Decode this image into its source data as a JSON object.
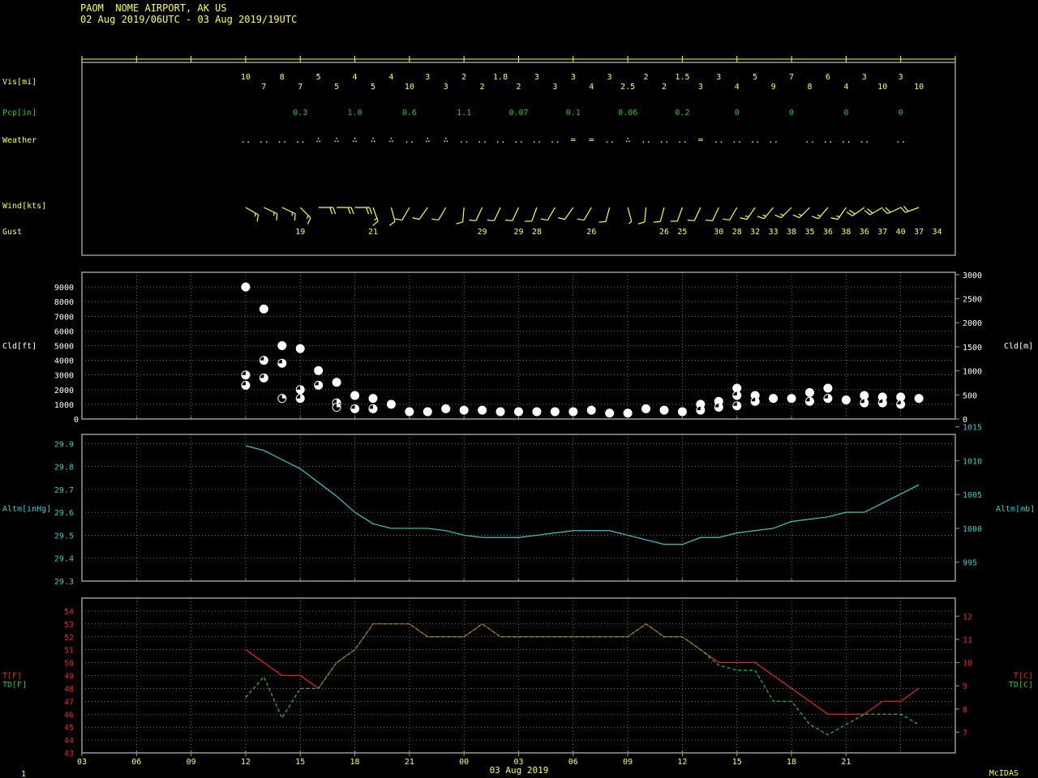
{
  "header": {
    "title": "PAOM  NOME AIRPORT, AK US",
    "subtitle": "02 Aug 2019/06UTC - 03 Aug 2019/19UTC"
  },
  "footer": {
    "left_label": "1",
    "date_label": "03 Aug 2019",
    "brand": "McIDAS"
  },
  "colors": {
    "yellow": "#ffff44",
    "green": "#22cc22",
    "cyan": "#33cccc",
    "red": "#ee2222",
    "white": "#ffffff",
    "frame": "#999999",
    "grid": "#aaaaaa"
  },
  "chart_data": [
    {
      "type": "table",
      "title": "Surface observations",
      "x_range": [
        -3,
        45
      ],
      "x_tick_labels": [
        "03",
        "06",
        "09",
        "12",
        "15",
        "18",
        "21",
        "00",
        "03",
        "06",
        "09",
        "12",
        "15",
        "18",
        "21"
      ],
      "hours": [
        6,
        7,
        8,
        9,
        10,
        11,
        12,
        13,
        14,
        15,
        16,
        17,
        18,
        19,
        20,
        21,
        22,
        23,
        24,
        25,
        26,
        27,
        28,
        29,
        30,
        31,
        32,
        33,
        34,
        35,
        36,
        37,
        38,
        39,
        40,
        41,
        42,
        43
      ],
      "rows": {
        "vis_label": "Vis[mi]",
        "vis": [
          "10",
          "7",
          "8",
          "7",
          "5",
          "5",
          "4",
          "5",
          "4",
          "10",
          "3",
          "3",
          "2",
          "2",
          "1.8",
          "2",
          "3",
          "3",
          "3",
          "4",
          "3",
          "2.5",
          "2",
          "2",
          "1.5",
          "3",
          "3",
          "4",
          "5",
          "9",
          "7",
          "8",
          "6",
          "4",
          "3",
          "10",
          "3",
          "10"
        ],
        "pcp_label": "Pcp[in]",
        "pcp": [
          {
            "hour": 9,
            "value": "0.3"
          },
          {
            "hour": 12,
            "value": "1.0"
          },
          {
            "hour": 15,
            "value": "0.6"
          },
          {
            "hour": 18,
            "value": "1.1"
          },
          {
            "hour": 21,
            "value": "0.07"
          },
          {
            "hour": 24,
            "value": "0.1"
          },
          {
            "hour": 27,
            "value": "0.06"
          },
          {
            "hour": 30,
            "value": "0.2"
          },
          {
            "hour": 33,
            "value": "0"
          },
          {
            "hour": 36,
            "value": "0"
          },
          {
            "hour": 39,
            "value": "0"
          },
          {
            "hour": 42,
            "value": "0"
          }
        ],
        "weather_label": "Weather",
        "weather": [
          "..",
          "..",
          "..",
          "..",
          "∴",
          "∴",
          "∴",
          "∴",
          "∴",
          "..",
          "∴",
          "∴",
          "..",
          "..",
          "..",
          "..",
          "..",
          "..",
          "=",
          "=",
          "..",
          "∴",
          "..",
          "..",
          "..",
          "=",
          "..",
          "..",
          "..",
          "..",
          "",
          "..",
          "..",
          "..",
          "..",
          "",
          ".."
        ],
        "wind_label": "Wind[kts]",
        "wind": [
          {
            "dir": 120,
            "spd": 15
          },
          {
            "dir": 115,
            "spd": 15
          },
          {
            "dir": 115,
            "spd": 15
          },
          {
            "dir": 135,
            "spd": 15
          },
          {
            "dir": 90,
            "spd": 20
          },
          {
            "dir": 90,
            "spd": 20
          },
          {
            "dir": 90,
            "spd": 20
          },
          {
            "dir": 160,
            "spd": 15
          },
          {
            "dir": 165,
            "spd": 10
          },
          {
            "dir": 210,
            "spd": 10
          },
          {
            "dir": 215,
            "spd": 10
          },
          {
            "dir": 210,
            "spd": 10
          },
          {
            "dir": 185,
            "spd": 10
          },
          {
            "dir": 205,
            "spd": 10
          },
          {
            "dir": 205,
            "spd": 10
          },
          {
            "dir": 205,
            "spd": 10
          },
          {
            "dir": 200,
            "spd": 10
          },
          {
            "dir": 210,
            "spd": 10
          },
          {
            "dir": 215,
            "spd": 10
          },
          {
            "dir": 210,
            "spd": 10
          },
          {
            "dir": 195,
            "spd": 10
          },
          {
            "dir": 165,
            "spd": 5
          },
          {
            "dir": 185,
            "spd": 10
          },
          {
            "dir": 195,
            "spd": 10
          },
          {
            "dir": 200,
            "spd": 10
          },
          {
            "dir": 205,
            "spd": 10
          },
          {
            "dir": 205,
            "spd": 10
          },
          {
            "dir": 210,
            "spd": 10
          },
          {
            "dir": 215,
            "spd": 15
          },
          {
            "dir": 220,
            "spd": 15
          },
          {
            "dir": 225,
            "spd": 15
          },
          {
            "dir": 225,
            "spd": 15
          },
          {
            "dir": 220,
            "spd": 15
          },
          {
            "dir": 215,
            "spd": 15
          },
          {
            "dir": 235,
            "spd": 20
          },
          {
            "dir": 240,
            "spd": 20
          },
          {
            "dir": 245,
            "spd": 20
          },
          {
            "dir": 250,
            "spd": 20
          }
        ],
        "gust_label": "Gust",
        "gust": [
          {
            "hour": 9,
            "value": "19"
          },
          {
            "hour": 13,
            "value": "21"
          },
          {
            "hour": 19,
            "value": "29"
          },
          {
            "hour": 21,
            "value": "29"
          },
          {
            "hour": 22,
            "value": "28"
          },
          {
            "hour": 25,
            "value": "26"
          },
          {
            "hour": 29,
            "value": "26"
          },
          {
            "hour": 30,
            "value": "25"
          },
          {
            "hour": 32,
            "value": "30"
          },
          {
            "hour": 33,
            "value": "28"
          },
          {
            "hour": 34,
            "value": "32"
          },
          {
            "hour": 35,
            "value": "33"
          },
          {
            "hour": 36,
            "value": "38"
          },
          {
            "hour": 37,
            "value": "35"
          },
          {
            "hour": 38,
            "value": "36"
          },
          {
            "hour": 39,
            "value": "38"
          },
          {
            "hour": 40,
            "value": "36"
          },
          {
            "hour": 41,
            "value": "37"
          },
          {
            "hour": 42,
            "value": "40"
          },
          {
            "hour": 43,
            "value": "37"
          },
          {
            "hour": 44,
            "value": "34"
          }
        ]
      }
    },
    {
      "type": "scatter",
      "ylabel": "Cld[ft]",
      "ylabel_right": "Cld[m]",
      "ylim": [
        0,
        10000
      ],
      "yticks": [
        1000,
        2000,
        3000,
        4000,
        5000,
        6000,
        7000,
        8000,
        9000
      ],
      "yticks_right_m": [
        0,
        500,
        1000,
        1500,
        2000,
        2500,
        3000
      ],
      "points": [
        {
          "hour": 6,
          "ft": 9000,
          "cover": "ovc"
        },
        {
          "hour": 6,
          "ft": 3000,
          "cover": "bkn"
        },
        {
          "hour": 6,
          "ft": 2300,
          "cover": "bkn"
        },
        {
          "hour": 7,
          "ft": 7500,
          "cover": "ovc"
        },
        {
          "hour": 7,
          "ft": 4000,
          "cover": "bkn"
        },
        {
          "hour": 7,
          "ft": 2800,
          "cover": "bkn"
        },
        {
          "hour": 8,
          "ft": 5000,
          "cover": "ovc"
        },
        {
          "hour": 8,
          "ft": 3800,
          "cover": "bkn"
        },
        {
          "hour": 8,
          "ft": 1400,
          "cover": "sct"
        },
        {
          "hour": 9,
          "ft": 4800,
          "cover": "ovc"
        },
        {
          "hour": 9,
          "ft": 2000,
          "cover": "bkn"
        },
        {
          "hour": 9,
          "ft": 1400,
          "cover": "bkn"
        },
        {
          "hour": 10,
          "ft": 3300,
          "cover": "ovc"
        },
        {
          "hour": 10,
          "ft": 2300,
          "cover": "bkn"
        },
        {
          "hour": 11,
          "ft": 2500,
          "cover": "ovc"
        },
        {
          "hour": 11,
          "ft": 1100,
          "cover": "sct"
        },
        {
          "hour": 11,
          "ft": 800,
          "cover": "sct"
        },
        {
          "hour": 12,
          "ft": 1600,
          "cover": "ovc"
        },
        {
          "hour": 12,
          "ft": 700,
          "cover": "bkn"
        },
        {
          "hour": 13,
          "ft": 1400,
          "cover": "ovc"
        },
        {
          "hour": 13,
          "ft": 700,
          "cover": "bkn"
        },
        {
          "hour": 14,
          "ft": 1000,
          "cover": "ovc"
        },
        {
          "hour": 15,
          "ft": 500,
          "cover": "ovc"
        },
        {
          "hour": 16,
          "ft": 500,
          "cover": "ovc"
        },
        {
          "hour": 17,
          "ft": 700,
          "cover": "ovc"
        },
        {
          "hour": 18,
          "ft": 600,
          "cover": "ovc"
        },
        {
          "hour": 19,
          "ft": 600,
          "cover": "ovc"
        },
        {
          "hour": 20,
          "ft": 500,
          "cover": "ovc"
        },
        {
          "hour": 21,
          "ft": 500,
          "cover": "ovc"
        },
        {
          "hour": 22,
          "ft": 500,
          "cover": "ovc"
        },
        {
          "hour": 23,
          "ft": 500,
          "cover": "ovc"
        },
        {
          "hour": 24,
          "ft": 500,
          "cover": "ovc"
        },
        {
          "hour": 25,
          "ft": 600,
          "cover": "ovc"
        },
        {
          "hour": 26,
          "ft": 400,
          "cover": "ovc"
        },
        {
          "hour": 27,
          "ft": 400,
          "cover": "ovc"
        },
        {
          "hour": 28,
          "ft": 700,
          "cover": "ovc"
        },
        {
          "hour": 29,
          "ft": 600,
          "cover": "ovc"
        },
        {
          "hour": 30,
          "ft": 500,
          "cover": "ovc"
        },
        {
          "hour": 31,
          "ft": 1000,
          "cover": "ovc"
        },
        {
          "hour": 31,
          "ft": 600,
          "cover": "bkn"
        },
        {
          "hour": 32,
          "ft": 1200,
          "cover": "ovc"
        },
        {
          "hour": 32,
          "ft": 800,
          "cover": "bkn"
        },
        {
          "hour": 33,
          "ft": 2100,
          "cover": "ovc"
        },
        {
          "hour": 33,
          "ft": 1600,
          "cover": "bkn"
        },
        {
          "hour": 33,
          "ft": 900,
          "cover": "bkn"
        },
        {
          "hour": 34,
          "ft": 1600,
          "cover": "ovc"
        },
        {
          "hour": 34,
          "ft": 1200,
          "cover": "bkn"
        },
        {
          "hour": 35,
          "ft": 1400,
          "cover": "ovc"
        },
        {
          "hour": 36,
          "ft": 1400,
          "cover": "ovc"
        },
        {
          "hour": 37,
          "ft": 1800,
          "cover": "ovc"
        },
        {
          "hour": 37,
          "ft": 1200,
          "cover": "bkn"
        },
        {
          "hour": 38,
          "ft": 2100,
          "cover": "ovc"
        },
        {
          "hour": 38,
          "ft": 1400,
          "cover": "bkn"
        },
        {
          "hour": 39,
          "ft": 1300,
          "cover": "ovc"
        },
        {
          "hour": 40,
          "ft": 1600,
          "cover": "ovc"
        },
        {
          "hour": 40,
          "ft": 1100,
          "cover": "bkn"
        },
        {
          "hour": 41,
          "ft": 1500,
          "cover": "ovc"
        },
        {
          "hour": 41,
          "ft": 1100,
          "cover": "bkn"
        },
        {
          "hour": 42,
          "ft": 1500,
          "cover": "ovc"
        },
        {
          "hour": 42,
          "ft": 1000,
          "cover": "bkn"
        },
        {
          "hour": 43,
          "ft": 1400,
          "cover": "ovc"
        }
      ]
    },
    {
      "type": "line",
      "ylabel": "Altm[inHg]",
      "ylabel_right": "Altm[mb]",
      "ylim": [
        29.3,
        29.94
      ],
      "yticks": [
        "29.3",
        "29.4",
        "29.5",
        "29.6",
        "29.7",
        "29.8",
        "29.9"
      ],
      "yticks_right_mb": [
        995,
        1000,
        1005,
        1010,
        1015
      ],
      "hours": [
        6,
        7,
        8,
        9,
        10,
        11,
        12,
        13,
        14,
        15,
        16,
        17,
        18,
        19,
        20,
        21,
        22,
        23,
        24,
        25,
        26,
        27,
        28,
        29,
        30,
        31,
        32,
        33,
        34,
        35,
        36,
        37,
        38,
        39,
        40,
        41,
        42,
        43
      ],
      "values": [
        29.89,
        29.87,
        29.83,
        29.79,
        29.73,
        29.67,
        29.6,
        29.55,
        29.53,
        29.53,
        29.53,
        29.52,
        29.5,
        29.49,
        29.49,
        29.49,
        29.5,
        29.51,
        29.52,
        29.52,
        29.52,
        29.5,
        29.48,
        29.46,
        29.46,
        29.49,
        29.49,
        29.51,
        29.52,
        29.53,
        29.56,
        29.57,
        29.58,
        29.6,
        29.6,
        29.64,
        29.68,
        29.72
      ]
    },
    {
      "type": "line",
      "ylabel": "T[F]",
      "ylabel2": "TD[F]",
      "ylabel_right": "T[C]",
      "ylabel_right2": "TD[C]",
      "ylim": [
        43,
        55
      ],
      "yticks": [
        43,
        44,
        45,
        46,
        47,
        48,
        49,
        50,
        51,
        52,
        53,
        54
      ],
      "yticks_right_c": [
        7,
        8,
        9,
        10,
        11,
        12
      ],
      "hours": [
        6,
        7,
        8,
        9,
        10,
        11,
        12,
        13,
        14,
        15,
        16,
        17,
        18,
        19,
        20,
        21,
        22,
        23,
        24,
        25,
        26,
        27,
        28,
        29,
        30,
        31,
        32,
        33,
        34,
        35,
        36,
        37,
        38,
        39,
        40,
        41,
        42,
        43
      ],
      "series": [
        {
          "name": "T[F]",
          "color": "#ee2222",
          "dash": false,
          "values": [
            51,
            50,
            49,
            49,
            48,
            50,
            51,
            53,
            53,
            53,
            52,
            52,
            52,
            53,
            52,
            52,
            52,
            52,
            52,
            52,
            52,
            52,
            53,
            52,
            52,
            51,
            50,
            50,
            50,
            49,
            48,
            47,
            46,
            46,
            46,
            47,
            47,
            48
          ]
        },
        {
          "name": "TD[F]",
          "color": "#22cc22",
          "dash": true,
          "values": [
            47.3,
            48.9,
            45.7,
            48,
            48,
            50,
            51,
            53,
            53,
            53,
            52,
            52,
            52,
            53,
            52,
            52,
            52,
            52,
            52,
            52,
            52,
            52,
            53,
            52,
            52,
            51,
            49.8,
            49.4,
            49.4,
            47,
            47,
            45.2,
            44.4,
            45.2,
            46,
            46,
            46,
            45.2
          ]
        }
      ]
    }
  ]
}
